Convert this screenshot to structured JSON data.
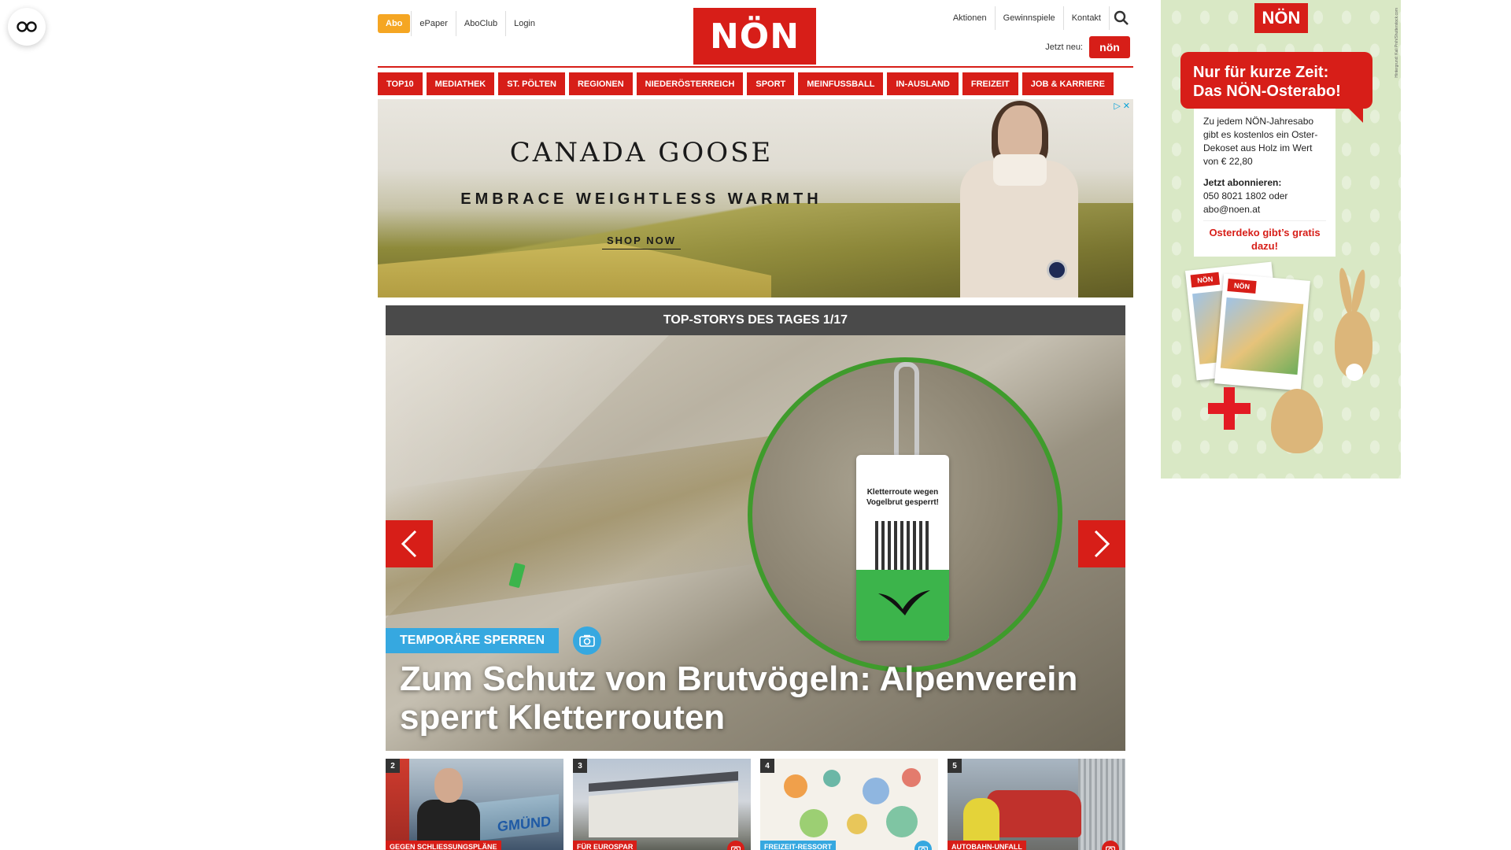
{
  "header": {
    "abo_label": "Abo",
    "top_links": [
      "ePaper",
      "AboClub",
      "Login"
    ],
    "logo_text": "NÖN",
    "right_links": [
      "Aktionen",
      "Gewinnspiele",
      "Kontakt"
    ],
    "jetzt_label": "Jetzt neu:",
    "mini_logo_text": "nön"
  },
  "nav": {
    "items": [
      "TOP10",
      "MEDIATHEK",
      "ST. PÖLTEN",
      "REGIONEN",
      "NIEDERÖSTERREICH",
      "SPORT",
      "MEINFUSSBALL",
      "IN-AUSLAND",
      "FREIZEIT",
      "JOB & KARRIERE"
    ]
  },
  "ad": {
    "brand": "CANADA GOOSE",
    "tagline": "EMBRACE WEIGHTLESS WARMTH",
    "cta": "SHOP NOW",
    "choice_icon": "▷",
    "close_icon": "✕"
  },
  "top_stories": {
    "header": "TOP-STORYS DES TAGES 1/17",
    "hero": {
      "kicker": "TEMPORÄRE SPERREN",
      "title": "Zum Schutz von Brutvögeln: Alpenverein sperrt Kletterrouten",
      "tag_text": "Kletterroute wegen Vogelbrut gesperrt!"
    },
    "cards": [
      {
        "num": "2",
        "kicker": "GEGEN SCHLIESSUNGSPLÄNE",
        "sign": "GMÜND"
      },
      {
        "num": "3",
        "kicker": "FÜR EUROSPAR"
      },
      {
        "num": "4",
        "kicker": "FREIZEIT-RESSORT"
      },
      {
        "num": "5",
        "kicker": "AUTOBAHN-UNFALL"
      }
    ]
  },
  "side_ad": {
    "logo": "NÖN",
    "headline": "Nur für kurze Zeit: Das NÖN-Osterabo!",
    "body": "Zu jedem NÖN-Jahresabo gibt es kostenlos ein Oster-Dekoset aus Holz im Wert von € 22,80",
    "cta_title": "Jetzt abonnieren:",
    "cta_contact": "050 8021 1802 oder abo@noen.at",
    "promo": "Osterdeko gibt’s gratis dazu!",
    "credit": "Hintergrund: Kali Pnih/Shutterstock.com",
    "paper_logo": "NÖN"
  },
  "colors": {
    "brand_red": "#d71e18",
    "accent_blue": "#36a8e0",
    "abo_orange": "#f5a623"
  }
}
